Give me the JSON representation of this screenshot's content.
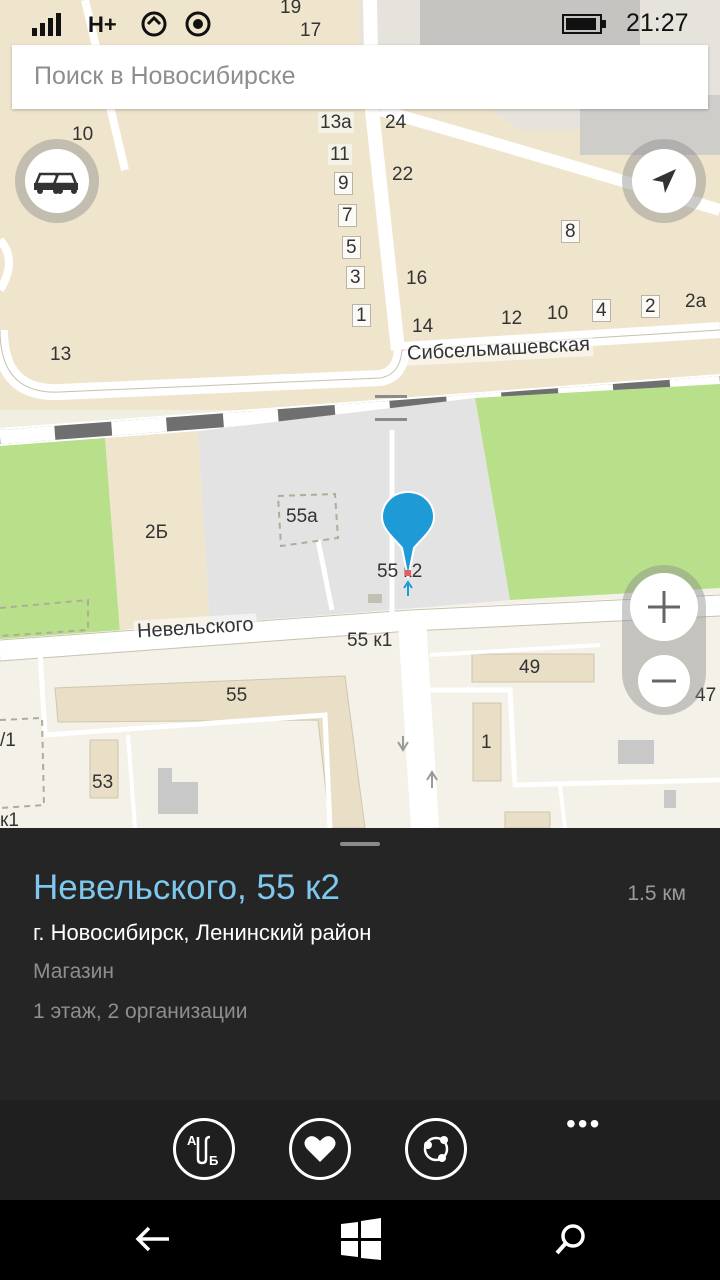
{
  "status_bar": {
    "signal_type": "H+",
    "time": "21:27"
  },
  "search": {
    "placeholder": "Поиск в Новосибирске"
  },
  "map": {
    "streets": [
      "Сибсельмашевская",
      "Невельского"
    ],
    "labels": [
      "19",
      "17",
      "10",
      "13а",
      "24",
      "11",
      "22",
      "9",
      "7",
      "8",
      "5",
      "3",
      "16",
      "1",
      "14",
      "12",
      "10",
      "4",
      "2",
      "2а",
      "13",
      "2Б",
      "55а",
      "55 к2",
      "55 к1",
      "49",
      "55",
      "47",
      "/1",
      "1",
      "53",
      "к1"
    ],
    "zoom_in_icon": "plus-icon",
    "zoom_out_icon": "minus-icon",
    "traffic_icon": "traffic-cars-icon",
    "locate_icon": "navigation-arrow-icon"
  },
  "panel": {
    "title": "Невельского, 55 к2",
    "distance": "1.5 км",
    "address": "г. Новосибирск, Ленинский район",
    "category": "Магазин",
    "organizations": "1 этаж, 2 организации"
  },
  "appbar": {
    "buttons": [
      "route-ab-icon",
      "favorite-heart-icon",
      "share-icon"
    ],
    "more_label": "•••"
  },
  "navbar": {
    "buttons": [
      "back-arrow-icon",
      "windows-start-icon",
      "search-icon"
    ]
  },
  "colors": {
    "accent": "#7ec8ee",
    "pin": "#1e9ad6",
    "panel_bg": "#252525"
  }
}
